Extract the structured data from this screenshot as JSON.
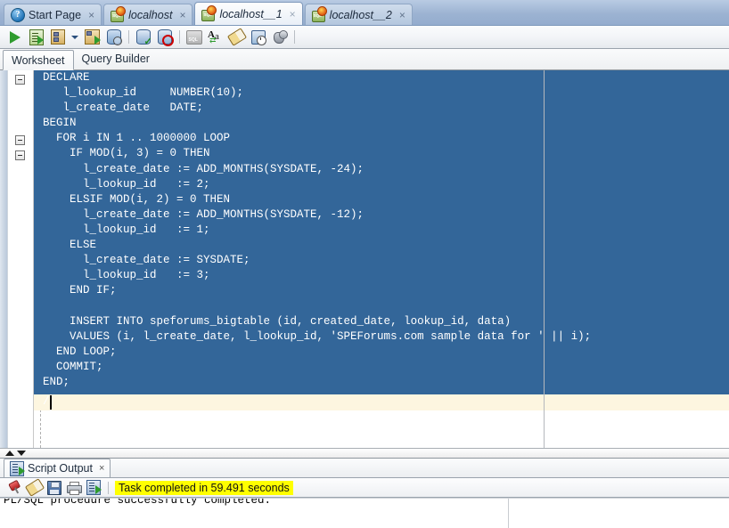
{
  "window": {
    "tabs": [
      {
        "label": "Start Page",
        "icon": "help-icon",
        "active": false,
        "italic": false,
        "close": "×"
      },
      {
        "label": "localhost",
        "icon": "sql-connection-icon",
        "active": false,
        "italic": true,
        "close": "×"
      },
      {
        "label": "localhost__1",
        "icon": "sql-connection-icon",
        "active": true,
        "italic": true,
        "close": "×"
      },
      {
        "label": "localhost__2",
        "icon": "sql-connection-icon",
        "active": false,
        "italic": true,
        "close": "×"
      }
    ]
  },
  "toolbar": {
    "buttons": [
      {
        "name": "run-statement-button",
        "icon": "play-icon",
        "tip": "Execute Statement"
      },
      {
        "name": "run-script-button",
        "icon": "run-script-icon",
        "tip": "Run Script"
      },
      {
        "name": "autotrace-button",
        "icon": "explain-tree-icon",
        "tip": "Autotrace"
      },
      {
        "name": "explain-plan-button",
        "icon": "explain-plan-icon",
        "tip": "Explain Plan"
      },
      {
        "name": "sql-history-button",
        "icon": "db-search-icon",
        "tip": "SQL History"
      },
      {
        "name": "commit-button",
        "icon": "db-check-icon",
        "tip": "Commit"
      },
      {
        "name": "rollback-button",
        "icon": "db-rollback-icon",
        "tip": "Rollback"
      },
      {
        "name": "unshared-sql-button",
        "icon": "sql-gray-icon",
        "tip": "Unshared SQL Worksheet"
      },
      {
        "name": "format-sql-button",
        "icon": "aa-swap-icon",
        "tip": "Format SQL"
      },
      {
        "name": "clear-button",
        "icon": "eraser-icon",
        "tip": "Clear"
      },
      {
        "name": "schedule-button",
        "icon": "clock-icon",
        "tip": "Schedule"
      },
      {
        "name": "query-builder-button",
        "icon": "bird-icon",
        "tip": "Query Builder"
      }
    ],
    "dropdown_caret": "▾"
  },
  "worksheet": {
    "tabs": [
      {
        "label": "Worksheet",
        "active": true
      },
      {
        "label": "Query Builder",
        "active": false
      }
    ]
  },
  "editor": {
    "code": "DECLARE\n   l_lookup_id     NUMBER(10);\n   l_create_date   DATE;\nBEGIN\n  FOR i IN 1 .. 1000000 LOOP\n    IF MOD(i, 3) = 0 THEN\n      l_create_date := ADD_MONTHS(SYSDATE, -24);\n      l_lookup_id   := 2;\n    ELSIF MOD(i, 2) = 0 THEN\n      l_create_date := ADD_MONTHS(SYSDATE, -12);\n      l_lookup_id   := 1;\n    ELSE\n      l_create_date := SYSDATE;\n      l_lookup_id   := 3;\n    END IF;\n\n    INSERT INTO speforums_bigtable (id, created_date, lookup_id, data)\n    VALUES (i, l_create_date, l_lookup_id, 'SPEForums.com sample data for ' || i);\n  END LOOP;\n  COMMIT;\nEND;",
    "last_line": "/",
    "selection_color": "#336699",
    "current_line_color": "#fdf6e0",
    "fold_rows": [
      0,
      4,
      5
    ],
    "right_margin_column_x": 610
  },
  "output_panel": {
    "tab_label": "Script Output",
    "tab_close": "×",
    "toolbar": [
      {
        "name": "pin-output-button",
        "icon": "pushpin-icon"
      },
      {
        "name": "clear-output-button",
        "icon": "eraser-icon"
      },
      {
        "name": "save-output-button",
        "icon": "save-icon"
      },
      {
        "name": "print-output-button",
        "icon": "printer-icon"
      },
      {
        "name": "run-script-output-button",
        "icon": "run-script-icon"
      }
    ],
    "status_text": "Task completed in 59.491 seconds",
    "status_highlight_color": "#ffff00",
    "content": "PL/SQL procedure successfully completed."
  },
  "splitter": {
    "up_arrow": "▲",
    "down_arrow": "▼"
  }
}
